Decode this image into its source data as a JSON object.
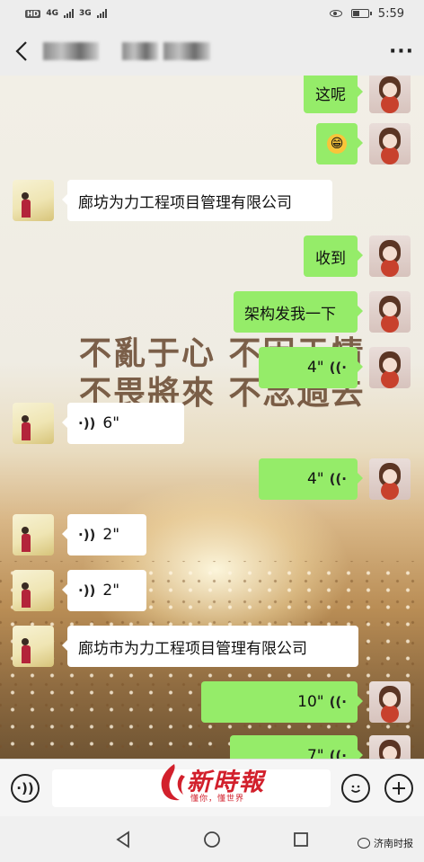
{
  "status_bar": {
    "network_badge": "HD",
    "signal1": "4G",
    "signal2": "3G",
    "time": "5:59"
  },
  "header": {
    "more_label": "···"
  },
  "background_text": {
    "line1": "不亂于心 不困于情",
    "line2": "不畏將來 不念過去"
  },
  "messages": [
    {
      "side": "right",
      "kind": "text",
      "text": "这呢"
    },
    {
      "side": "right",
      "kind": "emoji",
      "text": "😁"
    },
    {
      "side": "left",
      "kind": "text",
      "text": "廊坊为力工程项目管理有限公司"
    },
    {
      "side": "right",
      "kind": "text",
      "text": "收到"
    },
    {
      "side": "right",
      "kind": "text",
      "text": "架构发我一下"
    },
    {
      "side": "right",
      "kind": "voice",
      "text": "4\""
    },
    {
      "side": "left",
      "kind": "voice",
      "text": "6\""
    },
    {
      "side": "right",
      "kind": "voice",
      "text": "4\""
    },
    {
      "side": "left",
      "kind": "voice",
      "text": "2\""
    },
    {
      "side": "left",
      "kind": "voice",
      "text": "2\""
    },
    {
      "side": "left",
      "kind": "text",
      "text": "廊坊市为力工程项目管理有限公司"
    },
    {
      "side": "right",
      "kind": "voice",
      "text": "10\""
    },
    {
      "side": "right",
      "kind": "voice",
      "text": "7\""
    }
  ],
  "input_bar": {
    "voice_toggle_icon": "voice-icon",
    "emoji_icon": "emoji-icon",
    "plus_icon": "plus-icon"
  },
  "watermark": {
    "main": "新時報",
    "sub": "懂你，懂世界"
  },
  "corner_label": "济南时报",
  "colors": {
    "sent_bubble": "#95ec69",
    "received_bubble": "#ffffff",
    "watermark_red": "#d2202c"
  }
}
